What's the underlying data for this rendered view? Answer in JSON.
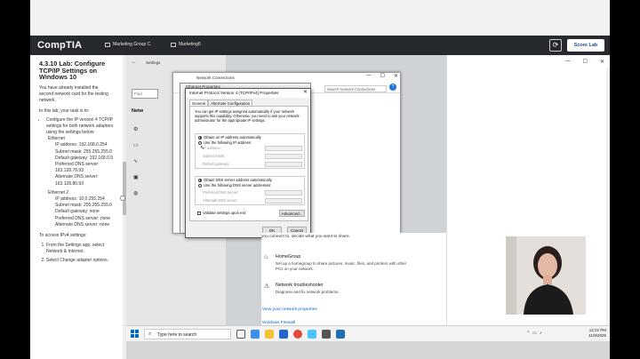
{
  "header": {
    "logo": "CompTIA",
    "tabs": [
      "Marketing Group C",
      "Marketing6"
    ],
    "score_label": "Score Lab"
  },
  "sidebar": {
    "title": "4.3.10 Lab: Configure TCP/IP Settings on Windows 10",
    "intro": "You have already installed the second network card for the testing network.",
    "task_intro": "In this lab, your task is to:",
    "task": "Configure the IP version 4 TCP/IP settings for both network adapters using the settings below:",
    "ethernet_label": "Ethernet",
    "ethernet_items": [
      "IP address: 192.168.0.254",
      "Subnet mask: 255.255.255.0",
      "Default gateway: 192.168.0.5",
      "Preferred DNS server: 163.128.78.93",
      "Alternate DNS server: 163.128.80.93"
    ],
    "ethernet2_label": "Ethernet 2",
    "ethernet2_items": [
      "IP address: 10.0.255.254",
      "Subnet mask: 255.255.255.0",
      "Default gateway: none",
      "Preferred DNS server: none",
      "Alternate DNS server: none"
    ],
    "access_intro": "To access IPv4 settings:",
    "steps": [
      "From the Settings app, select Network & Internet.",
      "Select Change adapter options."
    ]
  },
  "settings_app": {
    "title": "Settings",
    "find_placeholder": "Find",
    "network_label": "Netw"
  },
  "explorer": {
    "title": "Network Connections",
    "address": "onnections",
    "search_placeholder": "Search Network Connections",
    "props_title": "Ethernet Properties",
    "props_ok": "OK",
    "props_cancel": "Cancel"
  },
  "ipv4": {
    "title": "Internet Protocol Version 4 (TCP/IPv4) Properties",
    "tab_general": "General",
    "tab_alternate": "Alternate Configuration",
    "description": "You can get IP settings assigned automatically if your network supports this capability. Otherwise, you need to ask your network administrator for the appropriate IP settings.",
    "obtain_ip": "Obtain an IP address automatically",
    "use_ip": "Use the following IP address:",
    "ip_address": "IP address:",
    "subnet_mask": "Subnet mask:",
    "default_gateway": "Default gateway:",
    "obtain_dns": "Obtain DNS server address automatically",
    "use_dns": "Use the following DNS server addresses:",
    "preferred_dns": "Preferred DNS server:",
    "alternate_dns": "Alternate DNS server:",
    "validate": "Validate settings upon exit",
    "advanced": "Advanced...",
    "ok": "OK",
    "cancel": "Cancel"
  },
  "network_pane": {
    "line": "you connect to, decide what you want to share.",
    "homegroup_title": "HomeGroup",
    "homegroup_desc": "Set up a homegroup to share pictures, music, files, and printers with other PCs on your network.",
    "troubleshooter_title": "Network troubleshooter",
    "troubleshooter_desc": "Diagnose and fix network problems.",
    "link_properties": "View your network properties",
    "link_firewall": "Windows Firewall"
  },
  "taskbar": {
    "search_text": "Type here to search",
    "time": "12:22 PM",
    "date": "11/9/2025"
  },
  "colors": {
    "header_bg": "#26292e",
    "accent": "#1a4fa0",
    "link": "#0066cc"
  }
}
